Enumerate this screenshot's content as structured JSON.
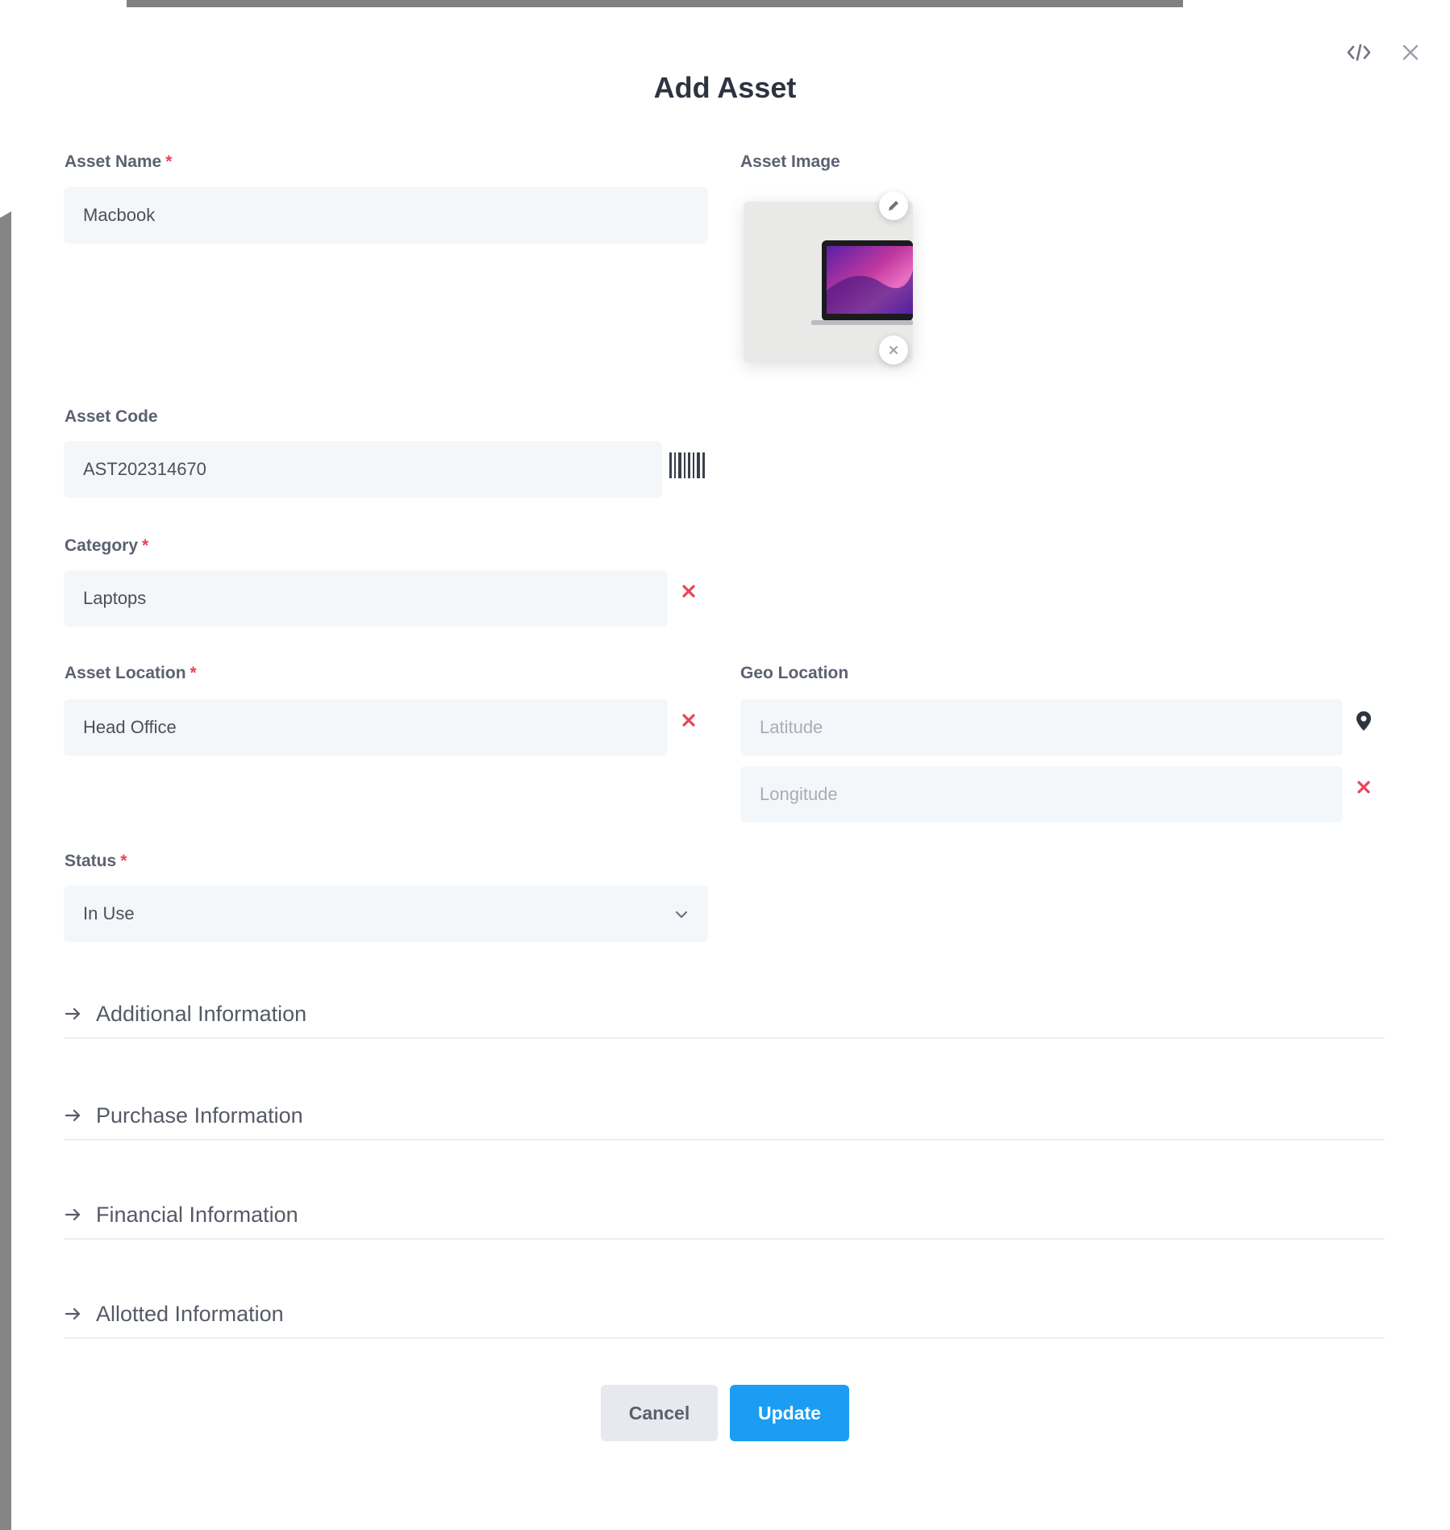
{
  "modal": {
    "title": "Add Asset"
  },
  "fields": {
    "asset_name": {
      "label": "Asset Name",
      "required_mark": "*",
      "value": "Macbook"
    },
    "asset_image": {
      "label": "Asset Image"
    },
    "asset_code": {
      "label": "Asset Code",
      "value": "AST202314670"
    },
    "category": {
      "label": "Category",
      "required_mark": "*",
      "value": "Laptops"
    },
    "asset_location": {
      "label": "Asset Location",
      "required_mark": "*",
      "value": "Head Office"
    },
    "geo_location": {
      "label": "Geo Location",
      "latitude_placeholder": "Latitude",
      "longitude_placeholder": "Longitude"
    },
    "status": {
      "label": "Status",
      "required_mark": "*",
      "value": "In Use"
    }
  },
  "sections": [
    {
      "label": "Additional Information"
    },
    {
      "label": "Purchase Information"
    },
    {
      "label": "Financial Information"
    },
    {
      "label": "Allotted Information"
    }
  ],
  "buttons": {
    "cancel": "Cancel",
    "update": "Update"
  },
  "colors": {
    "required": "#e8445a",
    "primary": "#1a9df2",
    "field_bg": "#f4f7fa"
  },
  "icons": [
    "code-icon",
    "close-icon",
    "edit-icon",
    "remove-image-icon",
    "barcode-icon",
    "clear-icon",
    "location-pin-icon",
    "chevron-down-icon",
    "arrow-right-icon"
  ]
}
